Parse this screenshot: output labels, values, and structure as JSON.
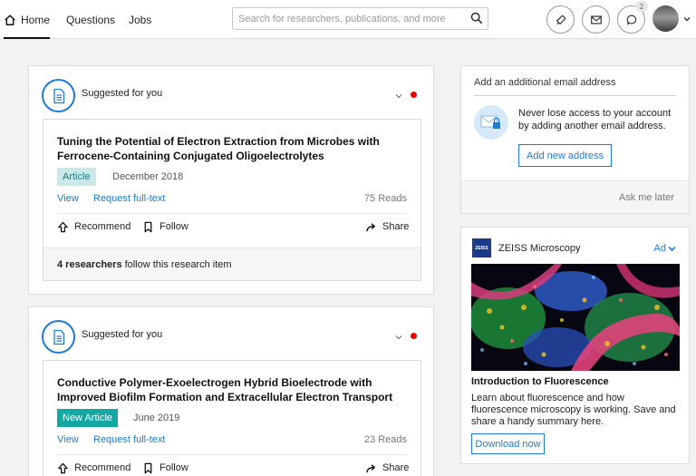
{
  "nav": {
    "home": "Home",
    "questions": "Questions",
    "jobs": "Jobs",
    "search_placeholder": "Search for researchers, publications, and more",
    "chat_badge": "2"
  },
  "feed": [
    {
      "header": "Suggested for you",
      "title": "Tuning the Potential of Electron Extraction from Microbes with Ferrocene-Containing Conjugated Oligoelectrolytes",
      "tag": "Article",
      "date": "December 2018",
      "view": "View",
      "request": "Request full-text",
      "reads": "75 Reads",
      "recommend": "Recommend",
      "follow": "Follow",
      "share": "Share",
      "footer_count": "4 researchers",
      "footer_text": "follow this research item"
    },
    {
      "header": "Suggested for you",
      "title": "Conductive Polymer-Exoelectrogen Hybrid Bioelectrode with Improved Biofilm Formation and Extracellular Electron Transport",
      "tag": "New Article",
      "date": "June 2019",
      "view": "View",
      "request": "Request full-text",
      "reads": "23 Reads",
      "recommend": "Recommend",
      "follow": "Follow",
      "share": "Share"
    }
  ],
  "email_panel": {
    "title": "Add an additional email address",
    "text": "Never lose access to your account by adding another email address.",
    "button": "Add new address",
    "later": "Ask me later"
  },
  "ad": {
    "logo": "ZEISS",
    "brand": "ZEISS Microscopy",
    "flag": "Ad",
    "headline": "Introduction to Fluorescence",
    "body": "Learn about fluorescence and how fluorescence microscopy is working. Save and share a handy summary here.",
    "button": "Download now"
  },
  "colors": {
    "accent": "#1f7bd3",
    "alert_dot": "#ee0000",
    "tag_article_bg": "#cce9ea",
    "tag_new_bg": "#12a7a3"
  }
}
